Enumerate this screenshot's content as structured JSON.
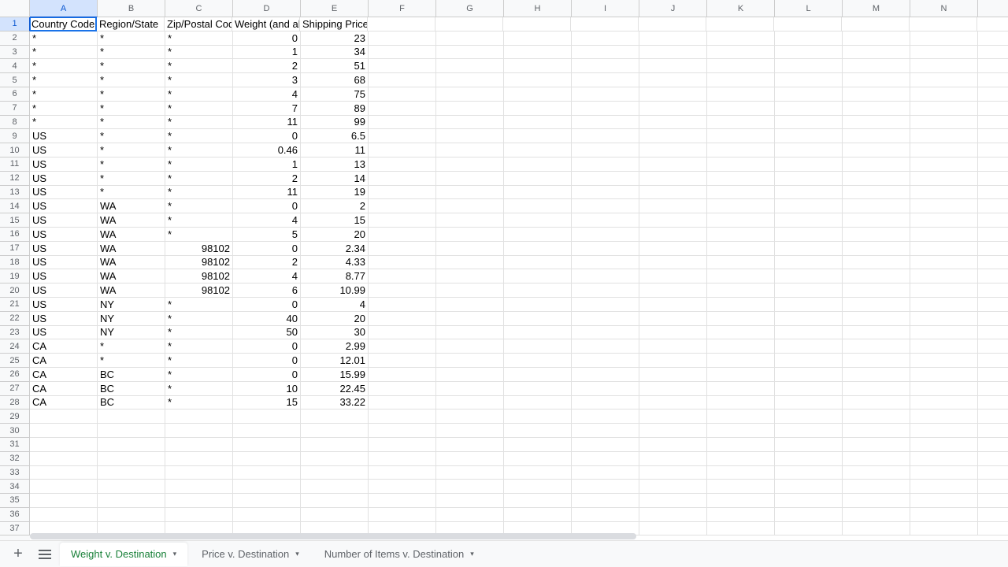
{
  "columns": [
    "A",
    "B",
    "C",
    "D",
    "E",
    "F",
    "G",
    "H",
    "I",
    "J",
    "K",
    "L",
    "M",
    "N"
  ],
  "rowCount": 37,
  "activeCell": {
    "row": 0,
    "col": 0
  },
  "headers": [
    "Country Code",
    "Region/State",
    "Zip/Postal Code",
    "Weight (and above)",
    "Shipping Price"
  ],
  "rows": [
    {
      "a": "*",
      "b": "*",
      "c": "*",
      "d": "0",
      "e": "23"
    },
    {
      "a": "*",
      "b": "*",
      "c": "*",
      "d": "1",
      "e": "34"
    },
    {
      "a": "*",
      "b": "*",
      "c": "*",
      "d": "2",
      "e": "51"
    },
    {
      "a": "*",
      "b": "*",
      "c": "*",
      "d": "3",
      "e": "68"
    },
    {
      "a": "*",
      "b": "*",
      "c": "*",
      "d": "4",
      "e": "75"
    },
    {
      "a": "*",
      "b": "*",
      "c": "*",
      "d": "7",
      "e": "89"
    },
    {
      "a": "*",
      "b": "*",
      "c": "*",
      "d": "11",
      "e": "99"
    },
    {
      "a": "US",
      "b": "*",
      "c": "*",
      "d": "0",
      "e": "6.5"
    },
    {
      "a": "US",
      "b": "*",
      "c": "*",
      "d": "0.46",
      "e": "11"
    },
    {
      "a": "US",
      "b": "*",
      "c": "*",
      "d": "1",
      "e": "13"
    },
    {
      "a": "US",
      "b": "*",
      "c": "*",
      "d": "2",
      "e": "14"
    },
    {
      "a": "US",
      "b": "*",
      "c": "*",
      "d": "11",
      "e": "19"
    },
    {
      "a": "US",
      "b": "WA",
      "c": "*",
      "d": "0",
      "e": "2"
    },
    {
      "a": "US",
      "b": "WA",
      "c": "*",
      "d": "4",
      "e": "15"
    },
    {
      "a": "US",
      "b": "WA",
      "c": "*",
      "d": "5",
      "e": "20"
    },
    {
      "a": "US",
      "b": "WA",
      "c": "98102",
      "d": "0",
      "e": "2.34",
      "cnum": true
    },
    {
      "a": "US",
      "b": "WA",
      "c": "98102",
      "d": "2",
      "e": "4.33",
      "cnum": true
    },
    {
      "a": "US",
      "b": "WA",
      "c": "98102",
      "d": "4",
      "e": "8.77",
      "cnum": true
    },
    {
      "a": "US",
      "b": "WA",
      "c": "98102",
      "d": "6",
      "e": "10.99",
      "cnum": true
    },
    {
      "a": "US",
      "b": "NY",
      "c": "*",
      "d": "0",
      "e": "4"
    },
    {
      "a": "US",
      "b": "NY",
      "c": "*",
      "d": "40",
      "e": "20"
    },
    {
      "a": "US",
      "b": "NY",
      "c": "*",
      "d": "50",
      "e": "30"
    },
    {
      "a": "CA",
      "b": "*",
      "c": "*",
      "d": "0",
      "e": "2.99"
    },
    {
      "a": "CA",
      "b": "*",
      "c": "*",
      "d": "0",
      "e": "12.01"
    },
    {
      "a": "CA",
      "b": "BC",
      "c": "*",
      "d": "0",
      "e": "15.99"
    },
    {
      "a": "CA",
      "b": "BC",
      "c": "*",
      "d": "10",
      "e": "22.45"
    },
    {
      "a": "CA",
      "b": "BC",
      "c": "*",
      "d": "15",
      "e": "33.22"
    }
  ],
  "tabs": [
    {
      "label": "Weight v. Destination",
      "active": true
    },
    {
      "label": "Price v. Destination",
      "active": false
    },
    {
      "label": "Number of Items v. Destination",
      "active": false
    }
  ]
}
